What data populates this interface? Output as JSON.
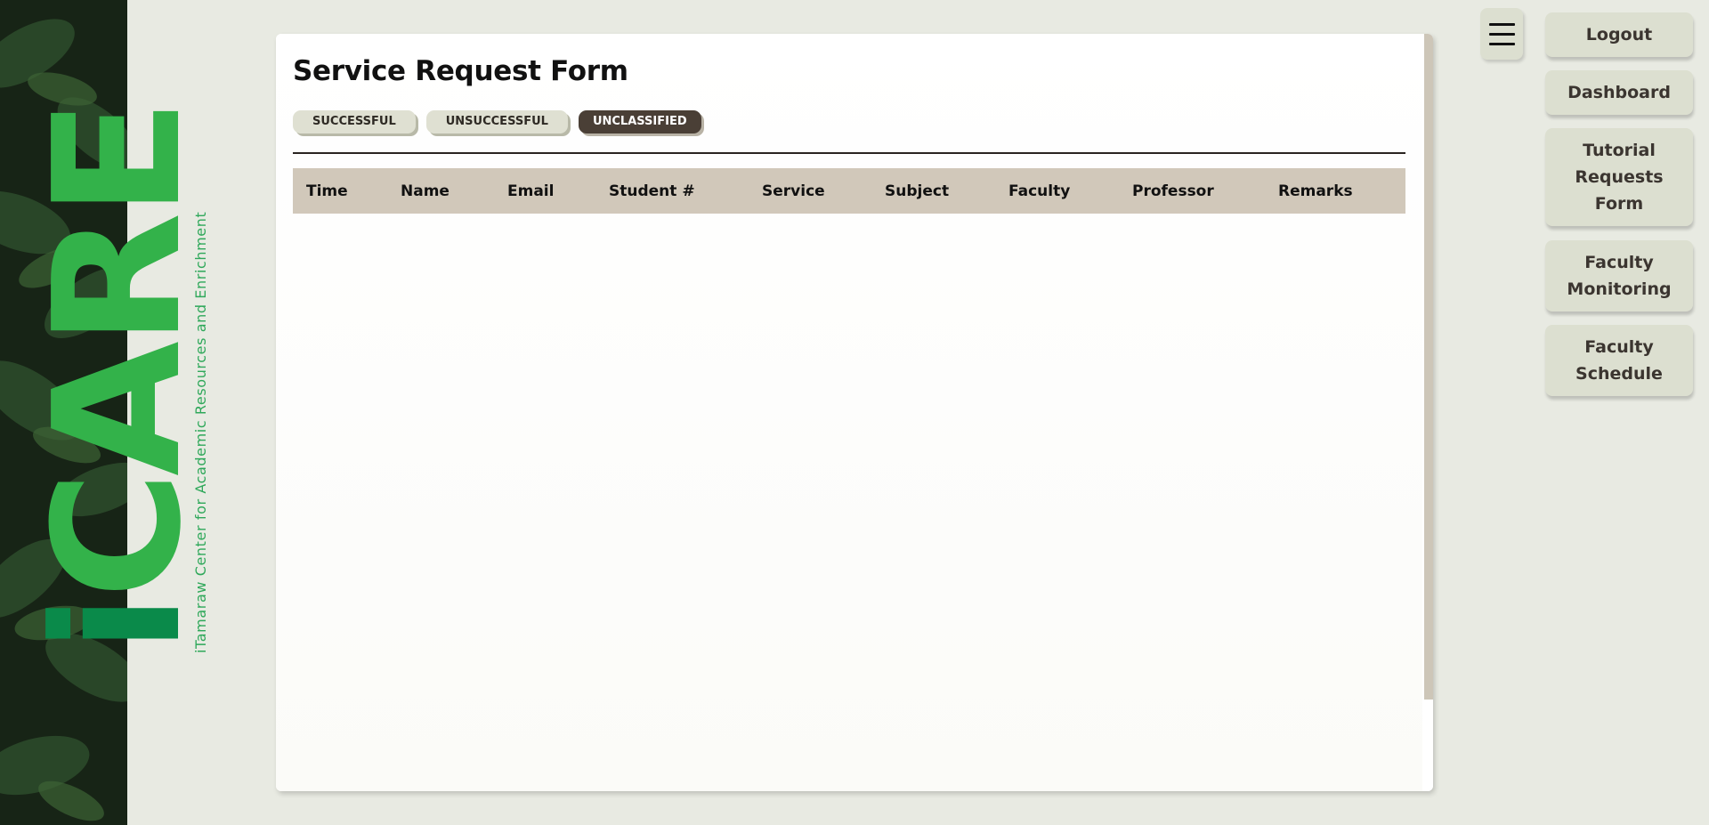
{
  "brand": {
    "name": "iCARE",
    "name_first": "i",
    "name_rest": "CARE",
    "subtitle": "iTamaraw Center for Academic Resources and Enrichment",
    "colors": {
      "primary": "#33b24a",
      "dark": "#0a8a4a"
    }
  },
  "main": {
    "title": "Service Request Form",
    "filters": [
      {
        "label": "SUCCESSFUL",
        "active": false
      },
      {
        "label": "UNSUCCESSFUL",
        "active": false
      },
      {
        "label": "UNCLASSIFIED",
        "active": true
      }
    ],
    "table": {
      "columns": [
        "Time",
        "Name",
        "Email",
        "Student #",
        "Service",
        "Subject",
        "Faculty",
        "Professor",
        "Remarks"
      ],
      "rows": []
    }
  },
  "nav": {
    "menu_icon": "hamburger-icon",
    "items": [
      {
        "label": "Logout"
      },
      {
        "label": "Dashboard"
      },
      {
        "label": "Tutorial Requests Form"
      },
      {
        "label": "Faculty Monitoring"
      },
      {
        "label": "Faculty Schedule"
      }
    ]
  },
  "colors": {
    "background": "#e8eae2",
    "table_header": "#d1c8ba",
    "button": "#dcdfd0",
    "active_filter": "#4a3f36"
  }
}
